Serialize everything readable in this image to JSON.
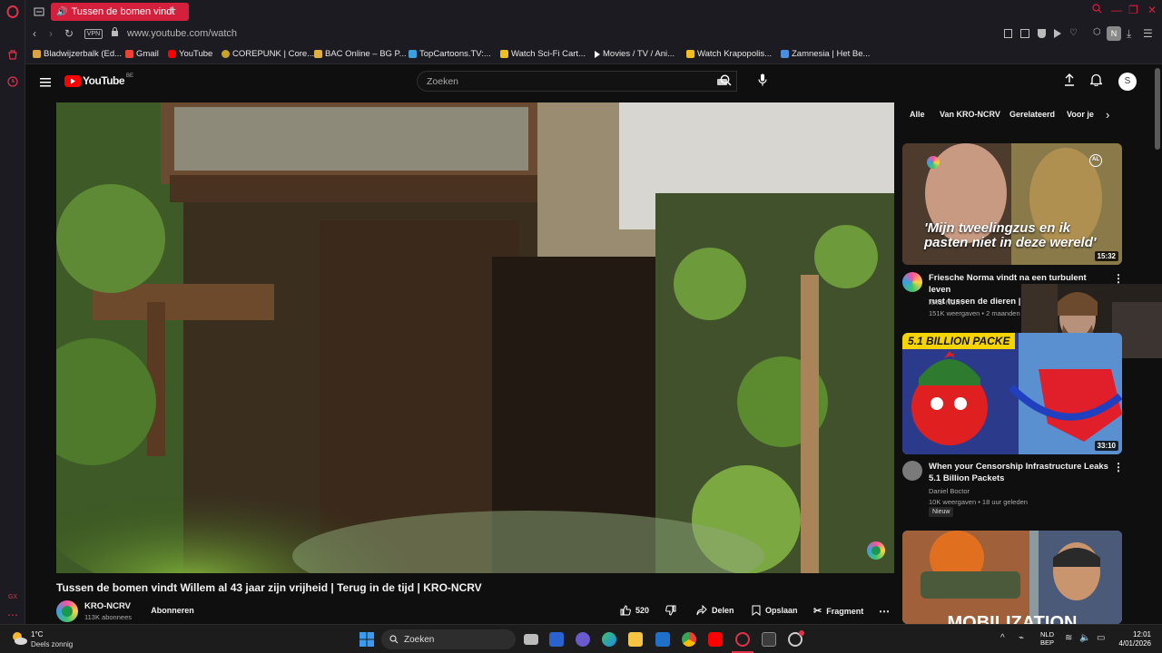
{
  "browser": {
    "tab_title": "Tussen de bomen vindt",
    "url": "www.youtube.com/watch",
    "vpn_label": "VPN",
    "bookmarks": [
      {
        "label": "Bladwijzerbalk (Ed...",
        "color": "#d9a441"
      },
      {
        "label": "Gmail",
        "color": "#ea4335"
      },
      {
        "label": "YouTube",
        "color": "#ff0000"
      },
      {
        "label": "COREPUNK | Core...",
        "color": "#c9a227"
      },
      {
        "label": "BAC Online – BG P...",
        "color": "#e0b040"
      },
      {
        "label": "TopCartoons.TV:...",
        "color": "#3aa0e0"
      },
      {
        "label": "Watch Sci-Fi Cart...",
        "color": "#f0c020"
      },
      {
        "label": "Movies / TV / Ani...",
        "color": "#ffffff"
      },
      {
        "label": "Watch Krapopolis...",
        "color": "#f0c020"
      },
      {
        "label": "Zamnesia | Het Be...",
        "color": "#4a8fe0"
      }
    ],
    "profile_letter": "N"
  },
  "youtube": {
    "logo": "YouTube",
    "region": "BE",
    "search_placeholder": "Zoeken",
    "user_initial": "S",
    "chips": [
      "Alle",
      "Van KRO-NCRV",
      "Gerelateerd",
      "Voor je"
    ],
    "video": {
      "title": "Tussen de bomen vindt Willem al 43 jaar zijn vrijheid | Terug in de tijd | KRO-NCRV",
      "channel": "KRO-NCRV",
      "subscribers": "113K abonnees",
      "subscribe_label": "Abonneren",
      "likes": "520",
      "share_label": "Delen",
      "save_label": "Opslaan",
      "clip_label": "Fragment"
    },
    "recommendations": [
      {
        "thumb_text": "'Mijn tweelingzus en ik pasten niet in deze wereld'",
        "duration": "15:32",
        "title_line1": "Friesche Norma vindt na een turbulent leven",
        "title_line2": "rust tussen de dieren | T",
        "channel": "KRO-NCRV",
        "meta": "151K weergaven • 2 maanden g",
        "badge": "AL"
      },
      {
        "thumb_text": "5.1 BILLION PACKE",
        "duration": "33:10",
        "title_line1": "When your Censorship Infrastructure Leaks",
        "title_line2": "5.1 Billion Packets",
        "channel": "Daniel Boctor",
        "meta": "10K weergaven • 18 uur geleden",
        "badge": "Nieuw"
      },
      {
        "thumb_text": "MOBILIZATION",
        "duration": "",
        "title_line1": "",
        "title_line2": "",
        "channel": "",
        "meta": "",
        "badge": ""
      }
    ]
  },
  "taskbar": {
    "weather_temp": "1°C",
    "weather_desc": "Deels zonnig",
    "search_label": "Zoeken",
    "lang_line1": "NLD",
    "lang_line2": "BEP",
    "time": "12:01",
    "date": "4/01/2026"
  }
}
